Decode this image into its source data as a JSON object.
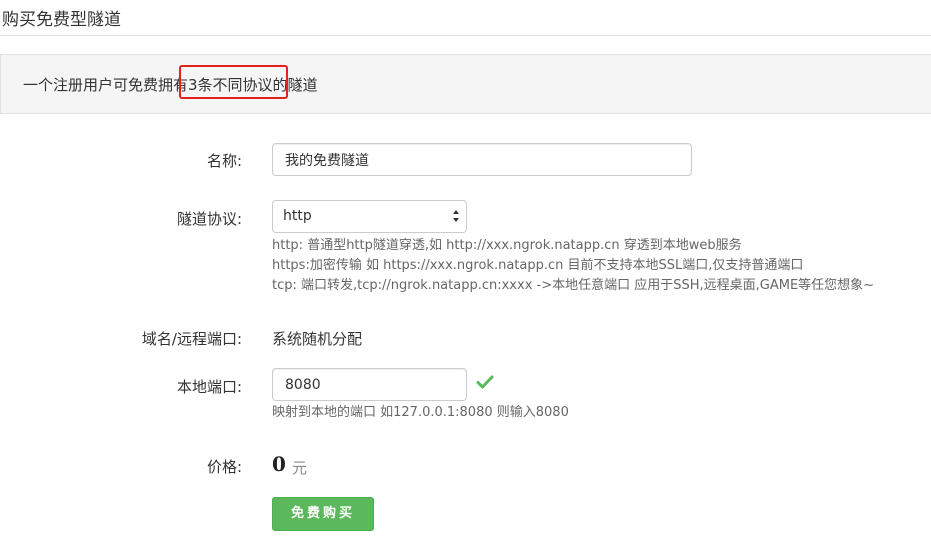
{
  "page": {
    "title": "购买免费型隧道"
  },
  "notice": {
    "text": "一个注册用户可免费拥有3条不同协议的隧道"
  },
  "form": {
    "name": {
      "label": "名称:",
      "value": "我的免费隧道"
    },
    "protocol": {
      "label": "隧道协议:",
      "selected": "http",
      "help": [
        "http: 普通型http隧道穿透,如 http://xxx.ngrok.natapp.cn 穿透到本地web服务",
        "https:加密传输 如 https://xxx.ngrok.natapp.cn 目前不支持本地SSL端口,仅支持普通端口",
        "tcp: 端口转发,tcp://ngrok.natapp.cn:xxxx ->本地任意端口 应用于SSH,远程桌面,GAME等任您想象~"
      ]
    },
    "domain_port": {
      "label": "域名/远程端口:",
      "value": "系统随机分配"
    },
    "local_port": {
      "label": "本地端口:",
      "value": "8080",
      "help": "映射到本地的端口 如127.0.0.1:8080 则输入8080"
    },
    "price": {
      "label": "价格:",
      "value": "0",
      "unit": "元"
    },
    "submit_label": "免费购买"
  },
  "colors": {
    "button_green": "#5cb85c",
    "check_green": "#5cb85c",
    "highlight_red": "#e2231a",
    "notice_bg": "#f5f5f5"
  },
  "icons": {
    "valid": "check-icon",
    "select": "up-down-arrows-icon"
  }
}
